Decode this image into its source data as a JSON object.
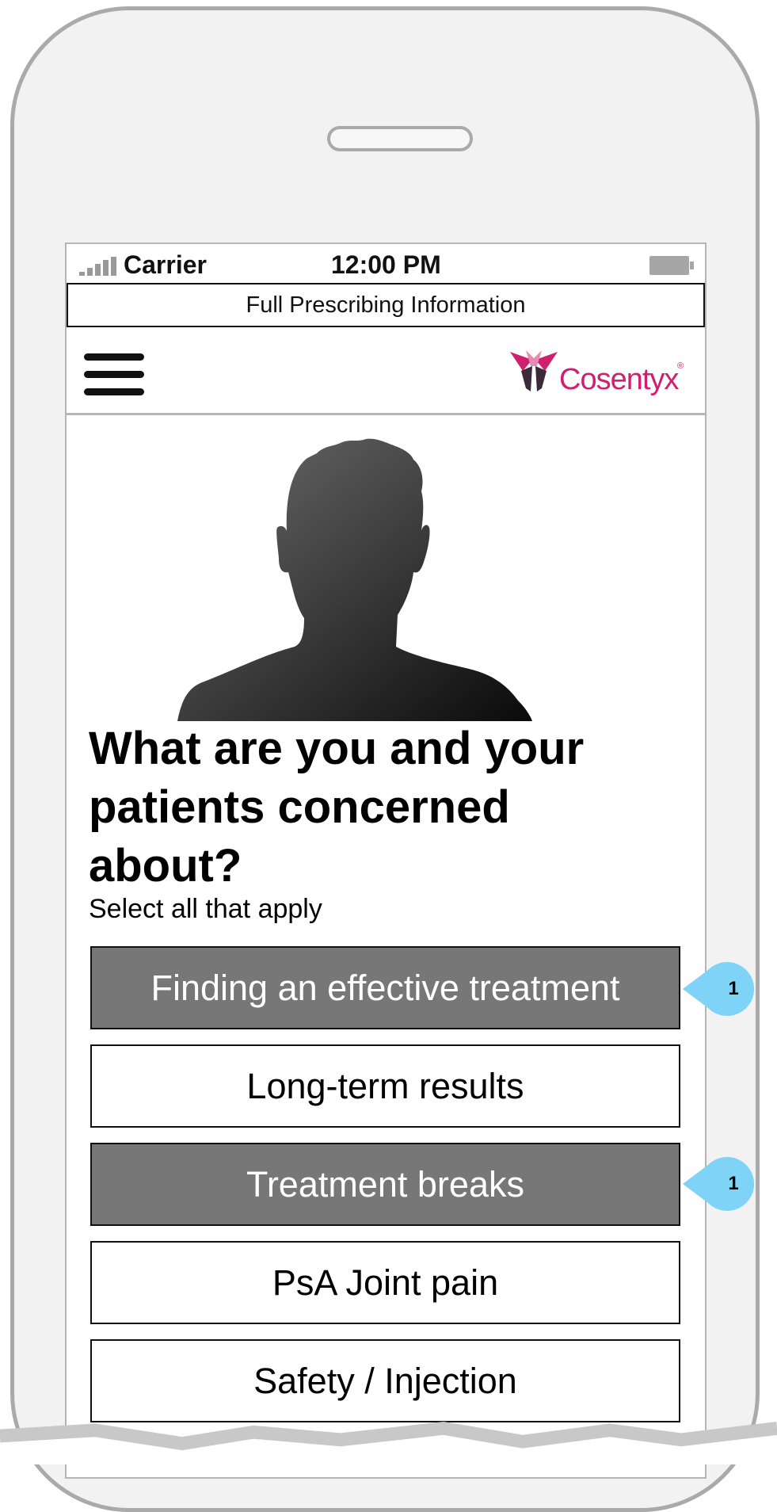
{
  "status_bar": {
    "carrier": "Carrier",
    "time": "12:00 PM"
  },
  "prescribing_link": "Full Prescribing Information",
  "brand": {
    "name": "Cosentyx",
    "reg_mark": "®",
    "color": "#d01f6f"
  },
  "hero": {
    "image": "person-silhouette"
  },
  "question": {
    "heading": "What are you and your patients concerned about?",
    "subtext": "Select all that apply"
  },
  "options": [
    {
      "label": "Finding an effective treatment",
      "selected": true,
      "annotation": "1"
    },
    {
      "label": "Long-term results",
      "selected": false
    },
    {
      "label": "Treatment breaks",
      "selected": true,
      "annotation": "1"
    },
    {
      "label": "PsA Joint pain",
      "selected": false
    },
    {
      "label": "Safety / Injection",
      "selected": false
    }
  ],
  "colors": {
    "selected_option": "#777777",
    "annotation_badge": "#7fd3f7",
    "device_frame": "#aaaaaa"
  },
  "icons": {
    "menu": "hamburger-menu-icon",
    "signal": "signal-strength-icon",
    "battery": "battery-icon"
  }
}
